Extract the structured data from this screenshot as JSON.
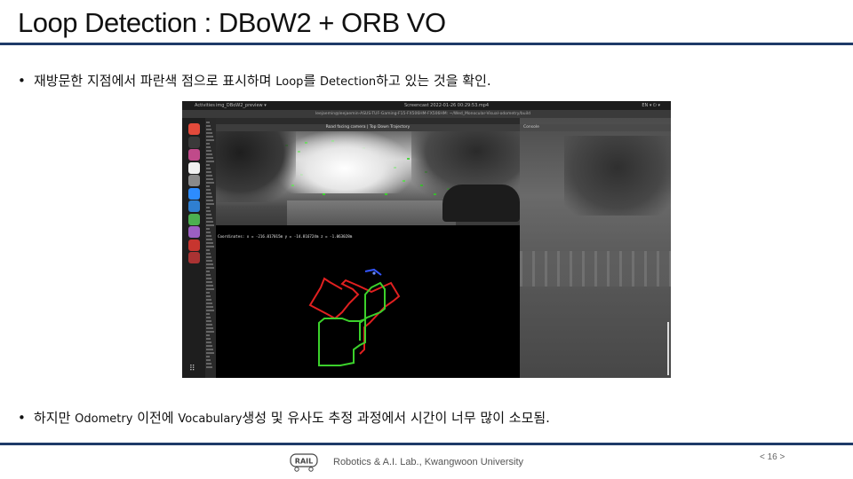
{
  "slide": {
    "title": "Loop Detection : DBoW2 + ORB VO",
    "bullets": [
      {
        "dot": "•",
        "parts": [
          "재방문한 지점에서 파란색 점으로 표시하며 ",
          "Loop",
          "를 ",
          "Detection",
          "하고 있는 것을 확인."
        ]
      },
      {
        "dot": "•",
        "parts": [
          "하지만 ",
          "Odometry",
          " 이전에 ",
          "Vocabulary",
          "생성 및 유사도 추정 과정에서 시간이 너무 많이 소모됨."
        ]
      }
    ]
  },
  "screenshot": {
    "topbar": {
      "activities": "Activities",
      "app": "img_DBoW2_preview ▾",
      "center": "Screencast 2022-01-26 00:29:53.mp4",
      "right": "EN ▾  ⏻ ▾"
    },
    "window_bar": "leejaemin@leejaemin-ASUS-TUF-Gaming-F15-FX506HM-FX506HM: ~/Wed_Monocular-Visual-odometry/build",
    "viewer_title": "Road facing camera | Top Down Trajectory",
    "right_pane_title": "Console",
    "coordinates_text": "Coordinates: x = -216.017015m y = -14.816724m z = -1.063028m",
    "dock_apps": [
      {
        "name": "chrome-icon",
        "color": "#e24a3b"
      },
      {
        "name": "terminal-icon",
        "color": "#3a3a3a"
      },
      {
        "name": "slack-icon",
        "color": "#c04a8a"
      },
      {
        "name": "github-icon",
        "color": "#f0f0f0"
      },
      {
        "name": "gear-icon",
        "color": "#8a8a8a"
      },
      {
        "name": "zoom-icon",
        "color": "#2d8cff"
      },
      {
        "name": "vscode-icon",
        "color": "#2f7fd1"
      },
      {
        "name": "chat-icon",
        "color": "#4caf50"
      },
      {
        "name": "notes-icon",
        "color": "#9c5fc2"
      },
      {
        "name": "video-icon",
        "color": "#c7352f"
      },
      {
        "name": "camera-icon",
        "color": "#a33"
      }
    ],
    "dock_grid": "⠿",
    "trajectory_colors": {
      "ground_truth": "#e02020",
      "estimated": "#3bd12b",
      "loop": "#3355ff"
    }
  },
  "footer": {
    "logo_text": "RAIL",
    "lab": "Robotics & A.I. Lab., Kwangwoon University",
    "page": "< 16 >"
  }
}
